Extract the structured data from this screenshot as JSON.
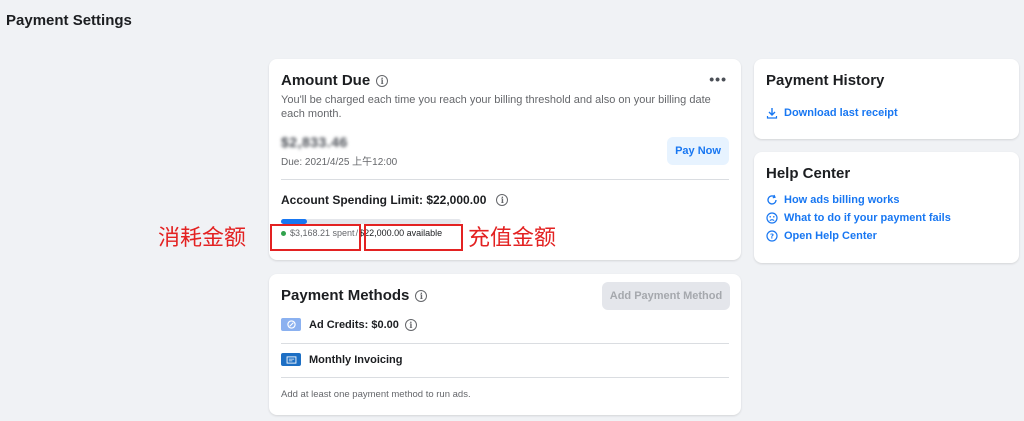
{
  "page": {
    "title": "Payment Settings"
  },
  "amount_due": {
    "title": "Amount Due",
    "description": "You'll be charged each time you reach your billing threshold and also on your billing date each month.",
    "amount": "$2,833.46",
    "due": "Due: 2021/4/25 上午12:00",
    "pay_now": "Pay Now",
    "spending_limit": "Account Spending Limit: $22,000.00",
    "spent": "$3,168.21 spent",
    "available": "$22,000.00 available",
    "spent_progress": 0.144
  },
  "payment_methods": {
    "title": "Payment Methods",
    "add_button": "Add Payment Method",
    "ad_credits": "Ad Credits: $0.00",
    "monthly_invoicing": "Monthly Invoicing",
    "footer": "Add at least one payment method to run ads."
  },
  "payment_history": {
    "title": "Payment History",
    "download": "Download last receipt"
  },
  "help_center": {
    "title": "Help Center",
    "links": [
      "How ads billing works",
      "What to do if your payment fails",
      "Open Help Center"
    ]
  },
  "annotations": {
    "left": "消耗金额",
    "right": "充值金额"
  },
  "colors": {
    "accent": "#1877f2",
    "annotation_red": "#e32222",
    "spent_dot": "#31a24c"
  },
  "icons": {
    "download": "download-icon",
    "refresh": "refresh-icon",
    "help": "help-circle-icon",
    "sad": "sad-face-icon"
  }
}
